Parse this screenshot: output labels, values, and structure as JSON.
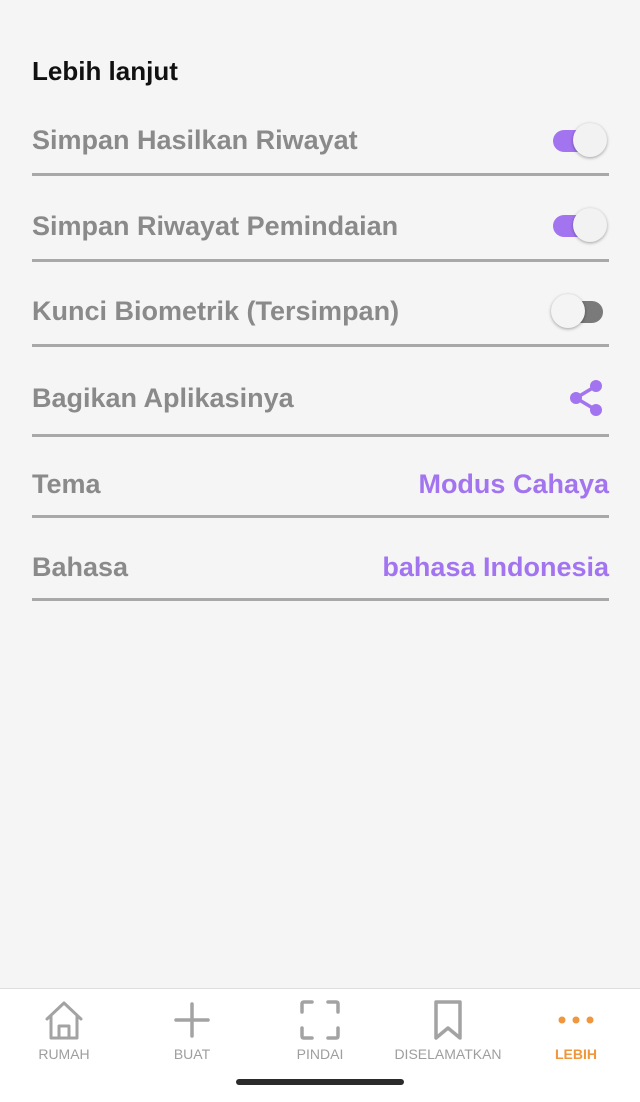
{
  "section": {
    "title": "Lebih lanjut"
  },
  "settings": [
    {
      "label": "Simpan Hasilkan Riwayat",
      "control": "toggle",
      "on": true
    },
    {
      "label": "Simpan Riwayat Pemindaian",
      "control": "toggle",
      "on": true
    },
    {
      "label": "Kunci Biometrik (Tersimpan)",
      "control": "toggle",
      "on": false
    },
    {
      "label": "Bagikan Aplikasinya",
      "control": "share-icon"
    },
    {
      "label": "Tema",
      "value": "Modus Cahaya"
    },
    {
      "label": "Bahasa",
      "value": "bahasa Indonesia"
    }
  ],
  "bottom_nav": [
    {
      "label": "RUMAH",
      "icon": "home-icon",
      "active": false
    },
    {
      "label": "BUAT",
      "icon": "plus-icon",
      "active": false
    },
    {
      "label": "PINDAI",
      "icon": "scan-frame-icon",
      "active": false
    },
    {
      "label": "DISELAMATKAN",
      "icon": "bookmark-icon",
      "active": false
    },
    {
      "label": "LEBIH",
      "icon": "more-dots-icon",
      "active": true
    }
  ],
  "colors": {
    "accent": "#a374f0",
    "active_nav": "#f0963c",
    "label_gray": "#8a8a8a",
    "divider": "#a8a8a8"
  }
}
